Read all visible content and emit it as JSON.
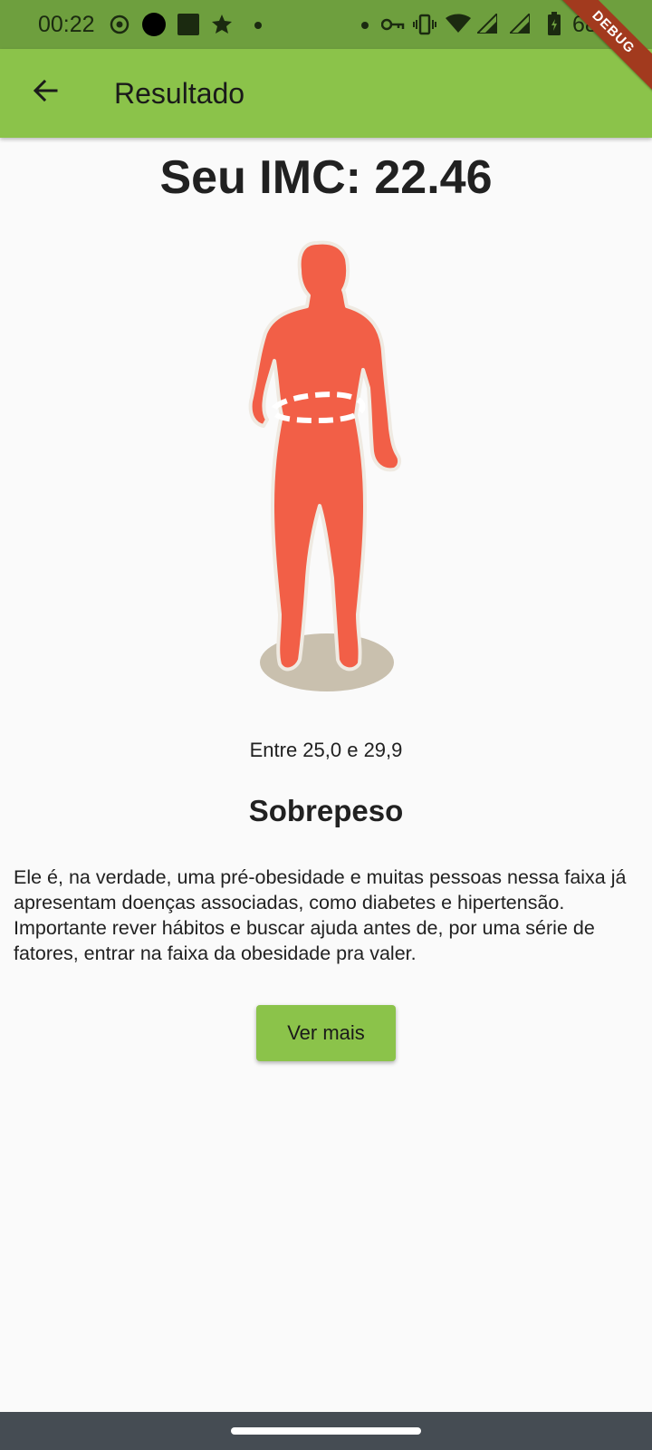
{
  "status_bar": {
    "time": "00:22",
    "battery_level": "68",
    "icons": [
      "media-icon",
      "dot-icon",
      "square-icon",
      "settings-app-icon",
      "small-dot-icon",
      "notification-dot-icon",
      "key-icon",
      "vibrate-icon",
      "wifi-icon",
      "signal-icon",
      "signal-icon-2",
      "battery-icon"
    ],
    "background_color": "#6E9F3E"
  },
  "debug_banner": {
    "label": "DEBUG",
    "color": "#A23A1E"
  },
  "app_bar": {
    "title": "Resultado",
    "back_icon": "arrow-back-icon",
    "background_color": "#8BC34A"
  },
  "result": {
    "imc_label": "Seu IMC: 22.46",
    "figure_icon": "body-silhouette-icon",
    "figure_color": "#F25F47",
    "range_text": "Entre 25,0 e 29,9",
    "category": "Sobrepeso",
    "description": "Ele é, na verdade, uma pré-obesidade e muitas pessoas nessa faixa já apresentam doenças associadas, como diabetes e hipertensão. Importante rever hábitos e buscar ajuda antes de, por uma série de fatores, entrar na faixa da obesidade pra valer.",
    "more_button_label": "Ver mais"
  }
}
